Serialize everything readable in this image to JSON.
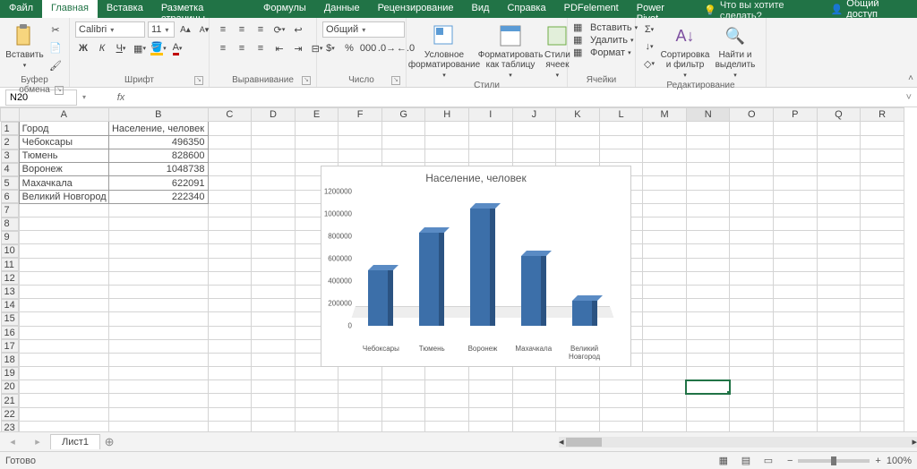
{
  "tabs": {
    "file": "Файл",
    "home": "Главная",
    "insert": "Вставка",
    "layout": "Разметка страницы",
    "formulas": "Формулы",
    "data": "Данные",
    "review": "Рецензирование",
    "view": "Вид",
    "help": "Справка",
    "pdf": "PDFelement",
    "powerpivot": "Power Pivot",
    "tell": "Что вы хотите сделать?",
    "share": "Общий доступ"
  },
  "ribbon": {
    "clipboard": {
      "group": "Буфер обмена",
      "paste": "Вставить"
    },
    "font": {
      "group": "Шрифт",
      "name": "Calibri",
      "size": "11",
      "bold": "Ж",
      "italic": "К",
      "underline": "Ч"
    },
    "align": {
      "group": "Выравнивание"
    },
    "number": {
      "group": "Число",
      "format": "Общий"
    },
    "styles": {
      "group": "Стили",
      "cond": "Условное форматирование",
      "table": "Форматировать как таблицу",
      "cell": "Стили ячеек"
    },
    "cells": {
      "group": "Ячейки",
      "insert": "Вставить",
      "delete": "Удалить",
      "format": "Формат"
    },
    "editing": {
      "group": "Редактирование",
      "sort": "Сортировка и фильтр",
      "find": "Найти и выделить"
    }
  },
  "namebox": "N20",
  "columns": [
    "A",
    "B",
    "C",
    "D",
    "E",
    "F",
    "G",
    "H",
    "I",
    "J",
    "K",
    "L",
    "M",
    "N",
    "O",
    "P",
    "Q",
    "R"
  ],
  "rows": 23,
  "selected": {
    "col": "N",
    "row": 20
  },
  "table": {
    "header": [
      "Город",
      "Население, человек"
    ],
    "rows": [
      [
        "Чебоксары",
        "496350"
      ],
      [
        "Тюмень",
        "828600"
      ],
      [
        "Воронеж",
        "1048738"
      ],
      [
        "Махачкала",
        "622091"
      ],
      [
        "Великий Новгород",
        "222340"
      ]
    ]
  },
  "chart_data": {
    "type": "bar",
    "title": "Население, человек",
    "categories": [
      "Чебоксары",
      "Тюмень",
      "Воронеж",
      "Махачкала",
      "Великий Новгород"
    ],
    "values": [
      496350,
      828600,
      1048738,
      622091,
      222340
    ],
    "ylim": [
      0,
      1200000
    ],
    "yticks": [
      0,
      200000,
      400000,
      600000,
      800000,
      1000000,
      1200000
    ],
    "xlabel": "",
    "ylabel": ""
  },
  "sheet_tab": "Лист1",
  "status": {
    "ready": "Готово",
    "zoom": "100%"
  }
}
